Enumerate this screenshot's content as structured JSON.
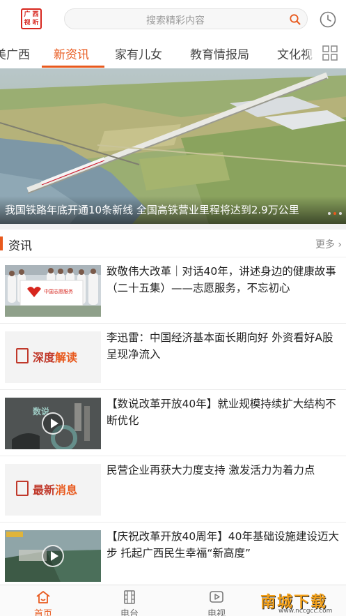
{
  "app": {
    "logo_chars": [
      "广",
      "西",
      "视",
      "听"
    ]
  },
  "search": {
    "placeholder": "搜索精彩内容"
  },
  "tabs": [
    {
      "label": "美广西"
    },
    {
      "label": "新资讯",
      "active": true
    },
    {
      "label": "家有儿女"
    },
    {
      "label": "教育情报局"
    },
    {
      "label": "文化视"
    }
  ],
  "banner": {
    "caption": "我国铁路年底开通10条新线 全国高铁营业里程将达到2.9万公里",
    "slide_count": 3,
    "active_slide": 1
  },
  "section": {
    "title": "资讯",
    "more_label": "更多"
  },
  "news": [
    {
      "title": "致敬伟大改革｜对话40年，讲述身边的健康故事（二十五集）——志愿服务，不忘初心",
      "thumb_type": "photo",
      "thumb_text": "中国志愿服务"
    },
    {
      "title": "李迅雷：中国经济基本面长期向好 外资看好A股呈现净流入",
      "thumb_type": "card",
      "card_a": "深度",
      "card_b": "解读"
    },
    {
      "title": "【数说改革开放40年】就业规模持续扩大结构不断优化",
      "thumb_type": "video",
      "thumb_text": "数说"
    },
    {
      "title": "民营企业再获大力度支持 激发活力为着力点",
      "thumb_type": "card",
      "card_a": "最新",
      "card_b": "消息"
    },
    {
      "title": "【庆祝改革开放40周年】40年基础设施建设迈大步 托起广西民生幸福“新高度”",
      "thumb_type": "video"
    }
  ],
  "bottom_nav": [
    {
      "label": "首页",
      "icon": "home-icon",
      "active": true
    },
    {
      "label": "电台",
      "icon": "film-icon"
    },
    {
      "label": "电视",
      "icon": "tv-play-icon"
    }
  ],
  "watermark": {
    "main": "南城下载",
    "sub": "www.nccgcc.com"
  },
  "colors": {
    "accent": "#e8591d",
    "brand_red": "#d7261e"
  }
}
